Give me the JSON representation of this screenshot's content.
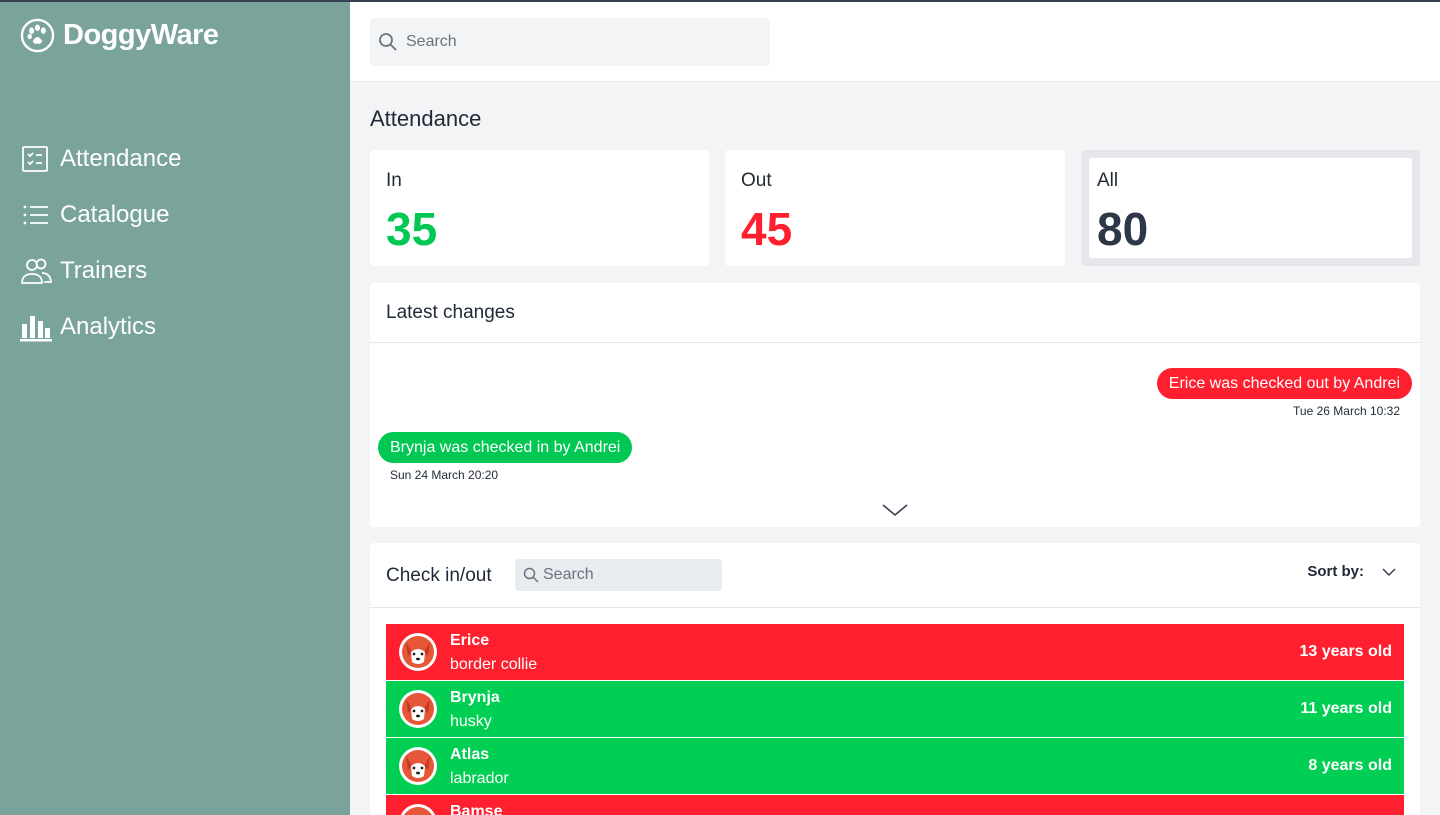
{
  "app": {
    "name": "DoggyWare"
  },
  "sidebar": {
    "items": [
      {
        "label": "Attendance",
        "icon": "checklist-icon"
      },
      {
        "label": "Catalogue",
        "icon": "list-icon"
      },
      {
        "label": "Trainers",
        "icon": "users-icon"
      },
      {
        "label": "Analytics",
        "icon": "bar-chart-icon"
      }
    ]
  },
  "search": {
    "placeholder": "Search"
  },
  "page": {
    "title": "Attendance"
  },
  "stats": {
    "in": {
      "label": "In",
      "value": "35"
    },
    "out": {
      "label": "Out",
      "value": "45"
    },
    "all": {
      "label": "All",
      "value": "80"
    }
  },
  "changes": {
    "title": "Latest changes",
    "items": [
      {
        "text": "Erice was checked out by Andrei",
        "time": "Tue 26 March 10:32",
        "status": "out"
      },
      {
        "text": "Brynja was checked in by Andrei",
        "time": "Sun 24 March 20:20",
        "status": "in"
      }
    ]
  },
  "checks": {
    "title": "Check in/out",
    "search_placeholder": "Search",
    "sort_label": "Sort by:",
    "rows": [
      {
        "name": "Erice",
        "breed": "border collie",
        "age": "13 years old",
        "status": "out"
      },
      {
        "name": "Brynja",
        "breed": "husky",
        "age": "11 years old",
        "status": "in"
      },
      {
        "name": "Atlas",
        "breed": "labrador",
        "age": "8 years old",
        "status": "in"
      },
      {
        "name": "Bamse",
        "breed": "",
        "age": "",
        "status": "out"
      }
    ]
  },
  "colors": {
    "sidebar": "#7aa39b",
    "in": "#00c853",
    "out": "#ff1f2f",
    "all": "#2d3748"
  }
}
